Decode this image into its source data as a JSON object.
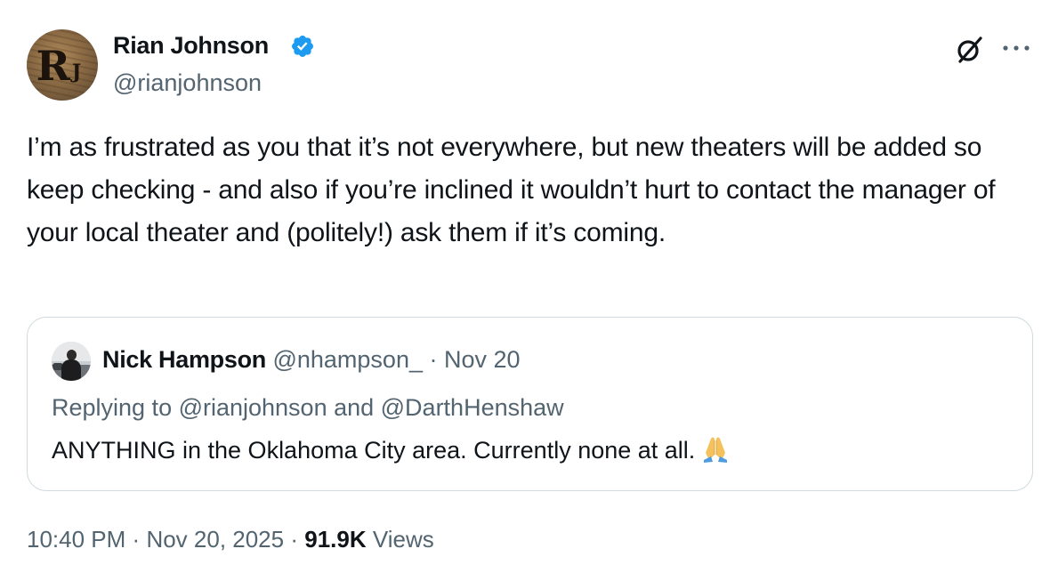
{
  "author": {
    "name": "Rian Johnson",
    "handle": "@rianjohnson",
    "avatar_letter": "R",
    "avatar_small_letter": "J",
    "verified_icon": "verified-badge-icon",
    "verified_color": "#1d9bf0"
  },
  "toolbar": {
    "grok_icon": "grok-icon",
    "more_icon": "more-horizontal-icon"
  },
  "tweet": {
    "text": "I’m as frustrated as you that it’s not everywhere, but new theaters will be added so keep checking - and also if you’re inclined it wouldn’t hurt to contact the manager of your local theater and (politely!) ask them if it’s coming."
  },
  "quote": {
    "name": "Nick Hampson",
    "handle": "@nhampson_",
    "separator": "·",
    "date": "Nov 20",
    "replying_to": "Replying to @rianjohnson and @DarthHenshaw",
    "text": "ANYTHING in the Oklahoma City area. Currently none at all.",
    "emoji": "folded-hands-emoji"
  },
  "footer": {
    "time": "10:40 PM",
    "separator": "·",
    "date": "Nov 20, 2025",
    "views_count": "91.9K",
    "views_label": "Views"
  },
  "colors": {
    "text_primary": "#0f1419",
    "text_secondary": "#536471",
    "border": "#cfd9de",
    "accent": "#1d9bf0"
  }
}
